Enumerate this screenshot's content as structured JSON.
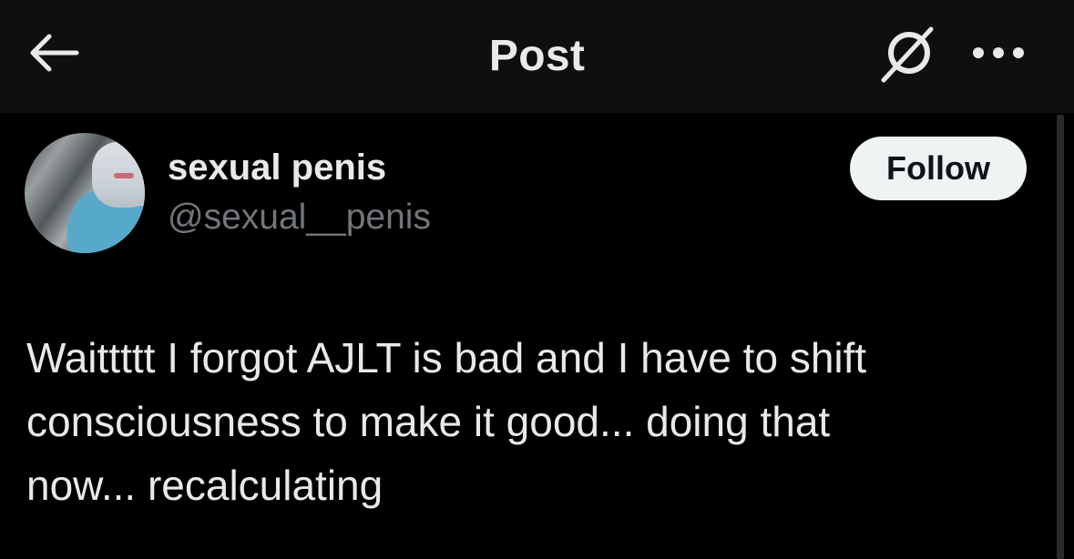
{
  "header": {
    "title": "Post",
    "back_icon": "arrow-left-icon",
    "grok_icon": "grok-icon",
    "more_icon": "more-horizontal-icon"
  },
  "author": {
    "display_name": "sexual penis",
    "handle": "@sexual__penis",
    "follow_label": "Follow"
  },
  "post": {
    "text_lines": [
      "Waittttt I forgot AJLT is bad and I have to shift",
      "consciousness to make it good... doing that",
      "now... recalculating"
    ]
  },
  "colors": {
    "background": "#000000",
    "header_background": "#0f0f10",
    "primary_text": "#e7e9ea",
    "secondary_text": "#71767b",
    "follow_button_bg": "#eff3f4",
    "follow_button_text": "#0f1419"
  }
}
